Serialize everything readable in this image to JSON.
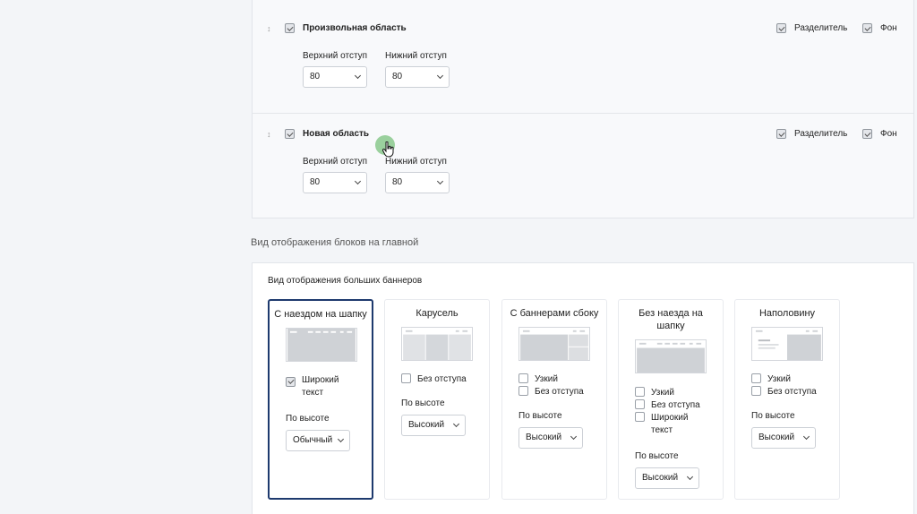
{
  "areas": [
    {
      "title": "Произвольная область",
      "divider": "Разделитель",
      "background": "Фон",
      "top_label": "Верхний отступ",
      "top_value": "80",
      "bottom_label": "Нижний отступ",
      "bottom_value": "80"
    },
    {
      "title": "Новая область",
      "divider": "Разделитель",
      "background": "Фон",
      "top_label": "Верхний отступ",
      "top_value": "80",
      "bottom_label": "Нижний отступ",
      "bottom_value": "80"
    }
  ],
  "blocks_section": {
    "title": "Вид отображения блоков на главной",
    "panel_title": "Вид отображения больших баннеров"
  },
  "cards": [
    {
      "title": "С наездом на шапку",
      "opt1": "Широкий текст",
      "height_label": "По высоте",
      "height_value": "Обычный"
    },
    {
      "title": "Карусель",
      "opt1": "Без отступа",
      "height_label": "По высоте",
      "height_value": "Высокий"
    },
    {
      "title": "С баннерами сбоку",
      "opt1": "Узкий",
      "opt2": "Без отступа",
      "height_label": "По высоте",
      "height_value": "Высокий"
    },
    {
      "title": "Без наезда на шапку",
      "opt1": "Узкий",
      "opt2": "Без отступа",
      "opt3": "Широкий текст",
      "height_label": "По высоте",
      "height_value": "Высокий"
    },
    {
      "title": "Наполовину",
      "opt1": "Узкий",
      "opt2": "Без отступа",
      "height_label": "По высоте",
      "height_value": "Высокий"
    }
  ],
  "colors": {
    "active_card_border": "#1e3a6e",
    "cursor_halo": "#4caf50"
  }
}
